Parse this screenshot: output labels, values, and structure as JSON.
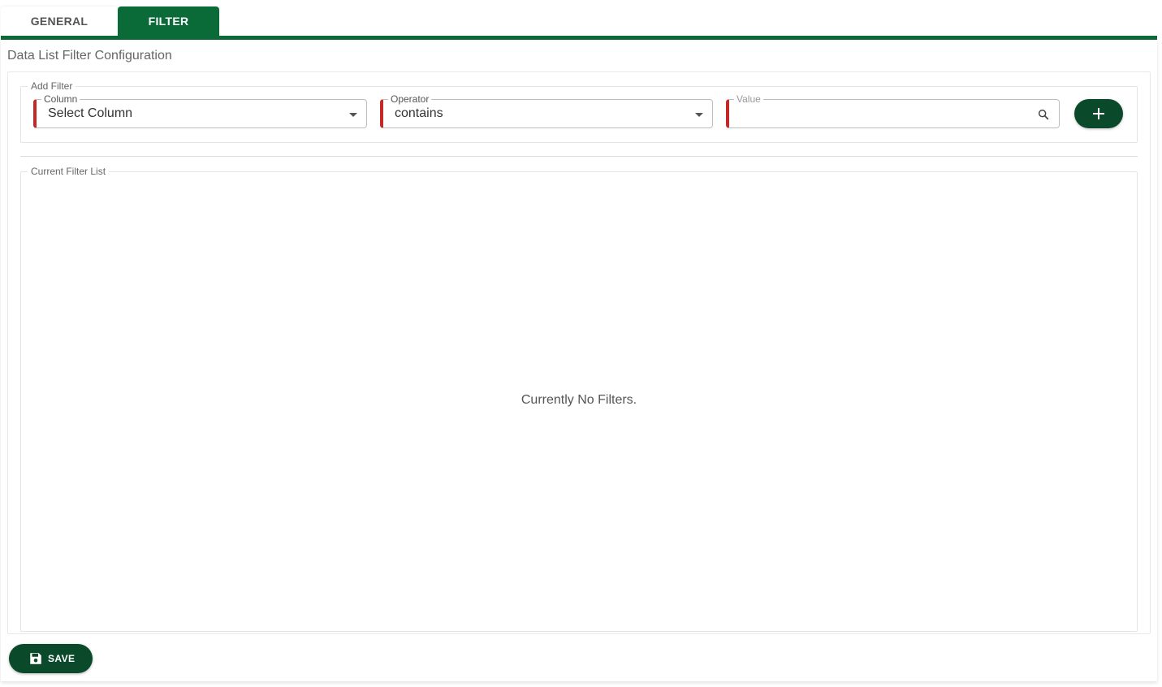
{
  "tabs": [
    {
      "label": "GENERAL",
      "active": false
    },
    {
      "label": "FILTER",
      "active": true
    }
  ],
  "page_title": "Data List Filter Configuration",
  "add_filter": {
    "legend": "Add Filter",
    "column": {
      "label": "Column",
      "value": "Select Column"
    },
    "operator": {
      "label": "Operator",
      "value": "contains"
    },
    "value": {
      "label": "Value",
      "value": ""
    },
    "add_button_icon": "plus-icon"
  },
  "current_filter_list": {
    "legend": "Current Filter List",
    "empty_message": "Currently No Filters."
  },
  "save_button": {
    "label": "SAVE",
    "icon": "floppy-disk-icon"
  },
  "colors": {
    "accent": "#0b6b38",
    "button": "#0a4a2a",
    "required": "#c62828"
  }
}
